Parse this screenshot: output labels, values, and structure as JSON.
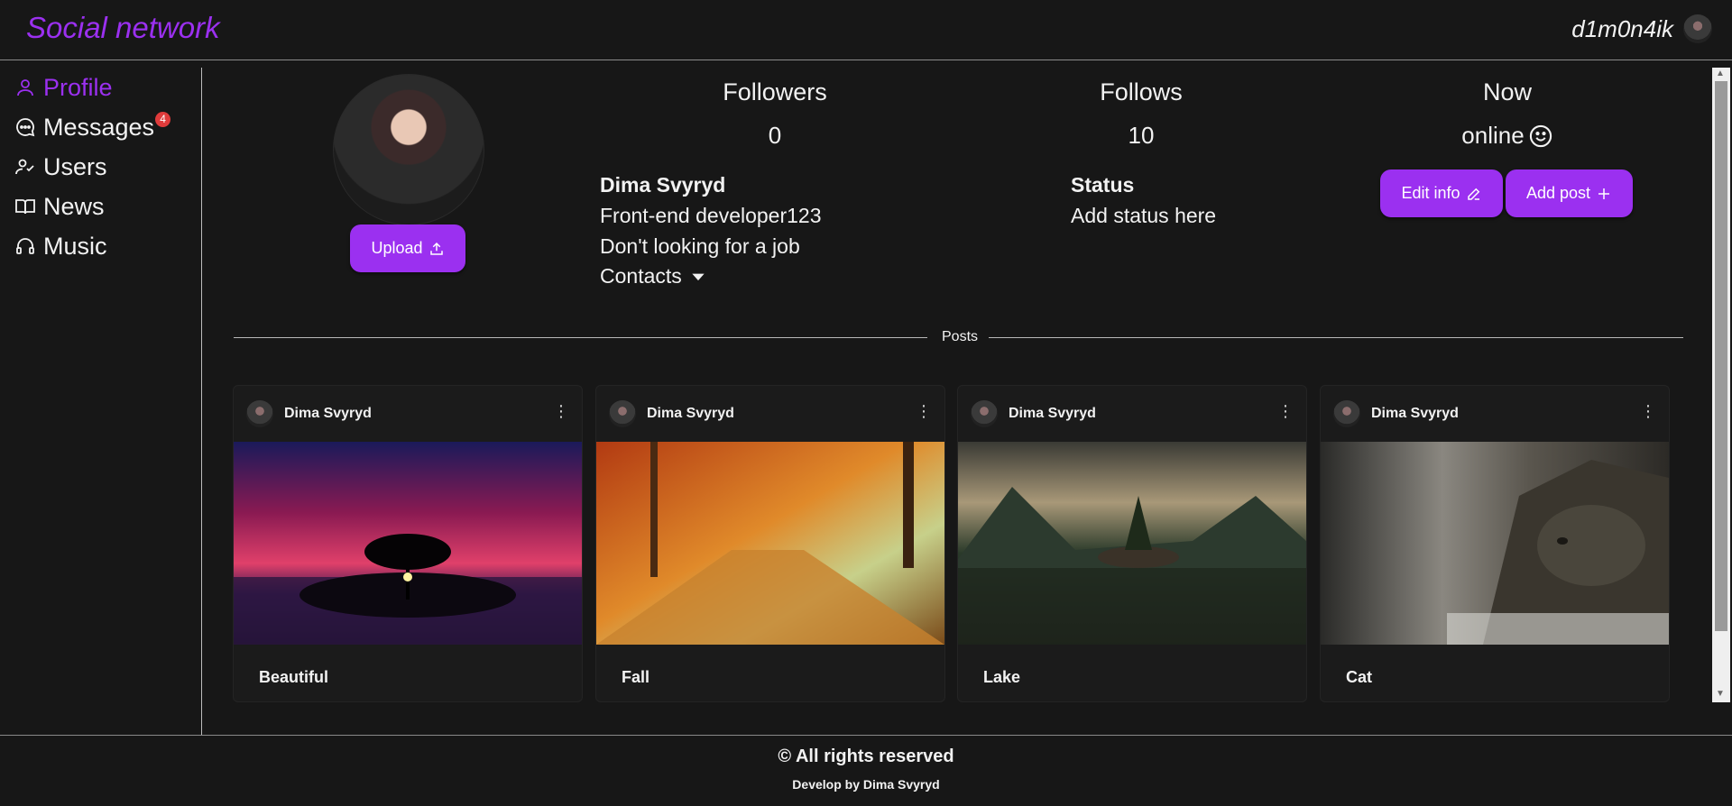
{
  "header": {
    "brand": "Social network",
    "username": "d1m0n4ik"
  },
  "sidebar": {
    "items": [
      {
        "label": "Profile",
        "icon": "user-icon",
        "active": true
      },
      {
        "label": "Messages",
        "icon": "chat-icon",
        "badge": "4"
      },
      {
        "label": "Users",
        "icon": "users-icon"
      },
      {
        "label": "News",
        "icon": "book-icon"
      },
      {
        "label": "Music",
        "icon": "headphones-icon"
      }
    ]
  },
  "profile": {
    "upload_label": "Upload",
    "followers_title": "Followers",
    "followers_value": "0",
    "follows_title": "Follows",
    "follows_value": "10",
    "now_title": "Now",
    "now_value": "online",
    "name": "Dima Svyryd",
    "about": "Front-end developer123",
    "job": "Don't looking for a job",
    "contacts": "Contacts",
    "status_title": "Status",
    "status_value": "Add status here",
    "edit_label": "Edit info",
    "add_post_label": "Add post"
  },
  "posts_section": {
    "label": "Posts",
    "items": [
      {
        "author": "Dima Svyryd",
        "title": "Beautiful",
        "image": "sunset-tree"
      },
      {
        "author": "Dima Svyryd",
        "title": "Fall",
        "image": "autumn-forest"
      },
      {
        "author": "Dima Svyryd",
        "title": "Lake",
        "image": "mountain-lake"
      },
      {
        "author": "Dima Svyryd",
        "title": "Cat",
        "image": "cat"
      }
    ]
  },
  "footer": {
    "copyright": "© All rights reserved",
    "credit": "Develop by Dima Svyryd"
  },
  "colors": {
    "accent": "#9b30f0",
    "background": "#171717",
    "badge": "#e03b3b"
  }
}
